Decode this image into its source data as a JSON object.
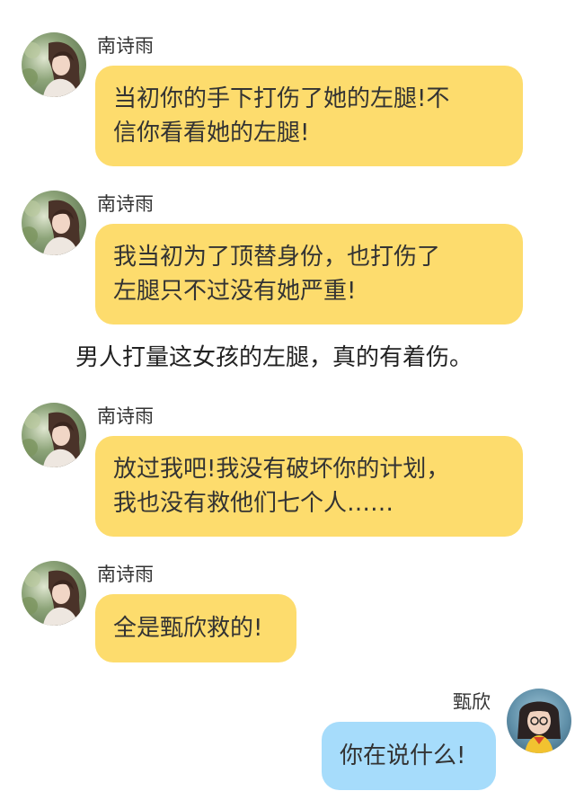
{
  "colors": {
    "left_bubble": "#fddc6d",
    "right_bubble": "#a6dcfb",
    "background": "#ffffff",
    "text": "#333333"
  },
  "messages": [
    {
      "sender": "南诗雨",
      "side": "left",
      "text": "当初你的手下打伤了她的左腿!不\n信你看看她的左腿!",
      "avatar_icon": "girl-avatar-icon"
    },
    {
      "sender": "南诗雨",
      "side": "left",
      "text": "我当初为了顶替身份，也打伤了\n左腿只不过没有她严重!",
      "avatar_icon": "girl-avatar-icon"
    },
    {
      "sender": "南诗雨",
      "side": "left",
      "text": "放过我吧!我没有破坏你的计划，\n我也没有救他们七个人……",
      "avatar_icon": "girl-avatar-icon"
    },
    {
      "sender": "南诗雨",
      "side": "left",
      "text": "全是甄欣救的!",
      "avatar_icon": "girl-avatar-icon"
    },
    {
      "sender": "甄欣",
      "side": "right",
      "text": "你在说什么!",
      "avatar_icon": "girl-avatar-icon"
    }
  ],
  "narration": "男人打量这女孩的左腿，真的有着伤。"
}
